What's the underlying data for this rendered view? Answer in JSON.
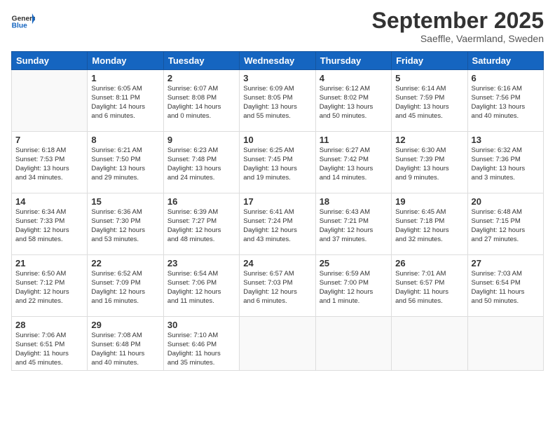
{
  "logo": {
    "line1": "General",
    "line2": "Blue"
  },
  "title": "September 2025",
  "subtitle": "Saeffle, Vaermland, Sweden",
  "days_header": [
    "Sunday",
    "Monday",
    "Tuesday",
    "Wednesday",
    "Thursday",
    "Friday",
    "Saturday"
  ],
  "weeks": [
    [
      {
        "day": "",
        "info": ""
      },
      {
        "day": "1",
        "info": "Sunrise: 6:05 AM\nSunset: 8:11 PM\nDaylight: 14 hours\nand 6 minutes."
      },
      {
        "day": "2",
        "info": "Sunrise: 6:07 AM\nSunset: 8:08 PM\nDaylight: 14 hours\nand 0 minutes."
      },
      {
        "day": "3",
        "info": "Sunrise: 6:09 AM\nSunset: 8:05 PM\nDaylight: 13 hours\nand 55 minutes."
      },
      {
        "day": "4",
        "info": "Sunrise: 6:12 AM\nSunset: 8:02 PM\nDaylight: 13 hours\nand 50 minutes."
      },
      {
        "day": "5",
        "info": "Sunrise: 6:14 AM\nSunset: 7:59 PM\nDaylight: 13 hours\nand 45 minutes."
      },
      {
        "day": "6",
        "info": "Sunrise: 6:16 AM\nSunset: 7:56 PM\nDaylight: 13 hours\nand 40 minutes."
      }
    ],
    [
      {
        "day": "7",
        "info": "Sunrise: 6:18 AM\nSunset: 7:53 PM\nDaylight: 13 hours\nand 34 minutes."
      },
      {
        "day": "8",
        "info": "Sunrise: 6:21 AM\nSunset: 7:50 PM\nDaylight: 13 hours\nand 29 minutes."
      },
      {
        "day": "9",
        "info": "Sunrise: 6:23 AM\nSunset: 7:48 PM\nDaylight: 13 hours\nand 24 minutes."
      },
      {
        "day": "10",
        "info": "Sunrise: 6:25 AM\nSunset: 7:45 PM\nDaylight: 13 hours\nand 19 minutes."
      },
      {
        "day": "11",
        "info": "Sunrise: 6:27 AM\nSunset: 7:42 PM\nDaylight: 13 hours\nand 14 minutes."
      },
      {
        "day": "12",
        "info": "Sunrise: 6:30 AM\nSunset: 7:39 PM\nDaylight: 13 hours\nand 9 minutes."
      },
      {
        "day": "13",
        "info": "Sunrise: 6:32 AM\nSunset: 7:36 PM\nDaylight: 13 hours\nand 3 minutes."
      }
    ],
    [
      {
        "day": "14",
        "info": "Sunrise: 6:34 AM\nSunset: 7:33 PM\nDaylight: 12 hours\nand 58 minutes."
      },
      {
        "day": "15",
        "info": "Sunrise: 6:36 AM\nSunset: 7:30 PM\nDaylight: 12 hours\nand 53 minutes."
      },
      {
        "day": "16",
        "info": "Sunrise: 6:39 AM\nSunset: 7:27 PM\nDaylight: 12 hours\nand 48 minutes."
      },
      {
        "day": "17",
        "info": "Sunrise: 6:41 AM\nSunset: 7:24 PM\nDaylight: 12 hours\nand 43 minutes."
      },
      {
        "day": "18",
        "info": "Sunrise: 6:43 AM\nSunset: 7:21 PM\nDaylight: 12 hours\nand 37 minutes."
      },
      {
        "day": "19",
        "info": "Sunrise: 6:45 AM\nSunset: 7:18 PM\nDaylight: 12 hours\nand 32 minutes."
      },
      {
        "day": "20",
        "info": "Sunrise: 6:48 AM\nSunset: 7:15 PM\nDaylight: 12 hours\nand 27 minutes."
      }
    ],
    [
      {
        "day": "21",
        "info": "Sunrise: 6:50 AM\nSunset: 7:12 PM\nDaylight: 12 hours\nand 22 minutes."
      },
      {
        "day": "22",
        "info": "Sunrise: 6:52 AM\nSunset: 7:09 PM\nDaylight: 12 hours\nand 16 minutes."
      },
      {
        "day": "23",
        "info": "Sunrise: 6:54 AM\nSunset: 7:06 PM\nDaylight: 12 hours\nand 11 minutes."
      },
      {
        "day": "24",
        "info": "Sunrise: 6:57 AM\nSunset: 7:03 PM\nDaylight: 12 hours\nand 6 minutes."
      },
      {
        "day": "25",
        "info": "Sunrise: 6:59 AM\nSunset: 7:00 PM\nDaylight: 12 hours\nand 1 minute."
      },
      {
        "day": "26",
        "info": "Sunrise: 7:01 AM\nSunset: 6:57 PM\nDaylight: 11 hours\nand 56 minutes."
      },
      {
        "day": "27",
        "info": "Sunrise: 7:03 AM\nSunset: 6:54 PM\nDaylight: 11 hours\nand 50 minutes."
      }
    ],
    [
      {
        "day": "28",
        "info": "Sunrise: 7:06 AM\nSunset: 6:51 PM\nDaylight: 11 hours\nand 45 minutes."
      },
      {
        "day": "29",
        "info": "Sunrise: 7:08 AM\nSunset: 6:48 PM\nDaylight: 11 hours\nand 40 minutes."
      },
      {
        "day": "30",
        "info": "Sunrise: 7:10 AM\nSunset: 6:46 PM\nDaylight: 11 hours\nand 35 minutes."
      },
      {
        "day": "",
        "info": ""
      },
      {
        "day": "",
        "info": ""
      },
      {
        "day": "",
        "info": ""
      },
      {
        "day": "",
        "info": ""
      }
    ]
  ]
}
